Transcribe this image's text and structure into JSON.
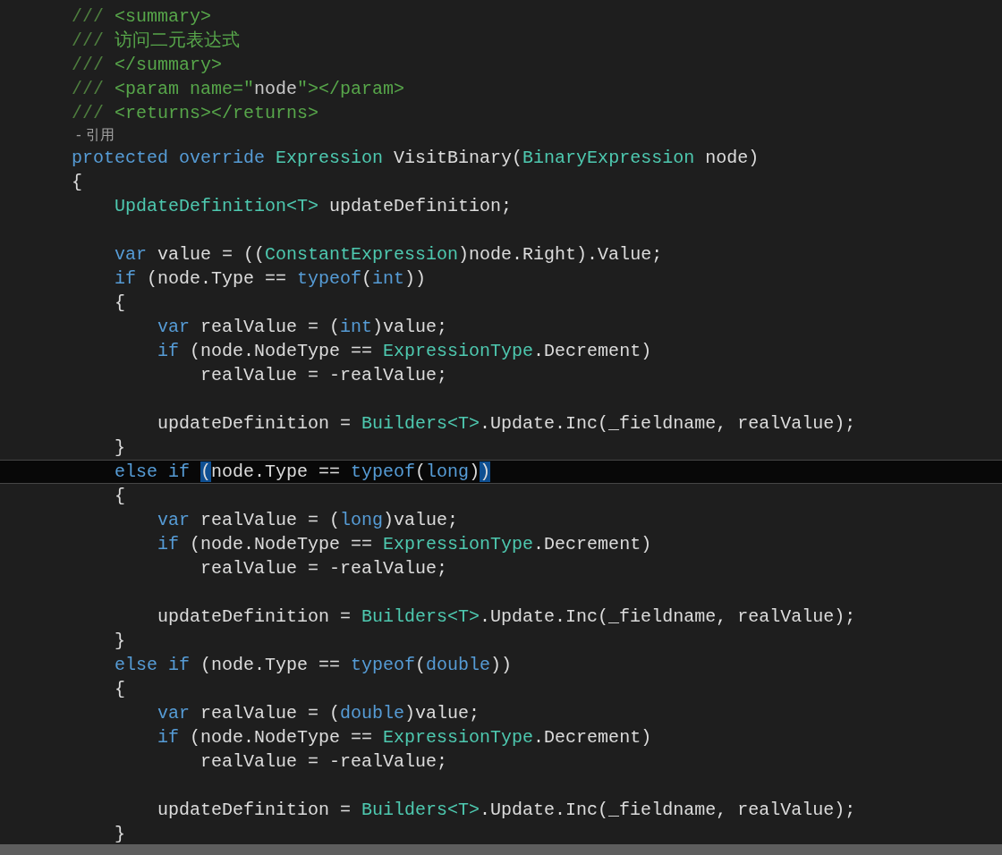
{
  "editor": {
    "lines": [
      {
        "kind": "code",
        "current": false,
        "tokens": [
          {
            "text": "///",
            "kind": "doc"
          },
          {
            "text": " <summary>",
            "kind": "comment"
          }
        ]
      },
      {
        "kind": "code",
        "current": false,
        "tokens": [
          {
            "text": "///",
            "kind": "doc"
          },
          {
            "text": " 访问二元表达式",
            "kind": "comment"
          }
        ]
      },
      {
        "kind": "code",
        "current": false,
        "tokens": [
          {
            "text": "///",
            "kind": "doc"
          },
          {
            "text": " </summary>",
            "kind": "comment"
          }
        ]
      },
      {
        "kind": "code",
        "current": false,
        "tokens": [
          {
            "text": "///",
            "kind": "doc"
          },
          {
            "text": " <param name=\"",
            "kind": "comment"
          },
          {
            "text": "node",
            "kind": "doc-value"
          },
          {
            "text": "\"></param>",
            "kind": "comment"
          }
        ]
      },
      {
        "kind": "code",
        "current": false,
        "tokens": [
          {
            "text": "///",
            "kind": "doc"
          },
          {
            "text": " <returns></returns>",
            "kind": "comment"
          }
        ]
      },
      {
        "kind": "codelens",
        "tokens": [
          {
            "text": " - 引用",
            "kind": "codelens"
          }
        ]
      },
      {
        "kind": "code",
        "current": false,
        "tokens": [
          {
            "text": "protected override ",
            "kind": "keyword"
          },
          {
            "text": "Expression",
            "kind": "type"
          },
          {
            "text": " VisitBinary(",
            "kind": "plain"
          },
          {
            "text": "BinaryExpression",
            "kind": "type"
          },
          {
            "text": " node)",
            "kind": "plain"
          }
        ]
      },
      {
        "kind": "code",
        "current": false,
        "tokens": [
          {
            "text": "{",
            "kind": "plain"
          }
        ]
      },
      {
        "kind": "code",
        "current": false,
        "tokens": [
          {
            "text": "    UpdateDefinition<T>",
            "kind": "type"
          },
          {
            "text": " updateDefinition;",
            "kind": "plain"
          }
        ]
      },
      {
        "kind": "blank"
      },
      {
        "kind": "code",
        "current": false,
        "tokens": [
          {
            "text": "    var",
            "kind": "keyword"
          },
          {
            "text": " value = ((",
            "kind": "plain"
          },
          {
            "text": "ConstantExpression",
            "kind": "type"
          },
          {
            "text": ")node.Right).Value;",
            "kind": "plain"
          }
        ]
      },
      {
        "kind": "code",
        "current": false,
        "tokens": [
          {
            "text": "    if",
            "kind": "keyword"
          },
          {
            "text": " (node.Type == ",
            "kind": "plain"
          },
          {
            "text": "typeof",
            "kind": "keyword"
          },
          {
            "text": "(",
            "kind": "plain"
          },
          {
            "text": "int",
            "kind": "keyword"
          },
          {
            "text": "))",
            "kind": "plain"
          }
        ]
      },
      {
        "kind": "code",
        "current": false,
        "tokens": [
          {
            "text": "    {",
            "kind": "plain"
          }
        ]
      },
      {
        "kind": "code",
        "current": false,
        "tokens": [
          {
            "text": "        var",
            "kind": "keyword"
          },
          {
            "text": " realValue = (",
            "kind": "plain"
          },
          {
            "text": "int",
            "kind": "keyword"
          },
          {
            "text": ")value;",
            "kind": "plain"
          }
        ]
      },
      {
        "kind": "code",
        "current": false,
        "tokens": [
          {
            "text": "        if",
            "kind": "keyword"
          },
          {
            "text": " (node.NodeType == ",
            "kind": "plain"
          },
          {
            "text": "ExpressionType",
            "kind": "type"
          },
          {
            "text": ".Decrement)",
            "kind": "plain"
          }
        ]
      },
      {
        "kind": "code",
        "current": false,
        "tokens": [
          {
            "text": "            realValue = -realValue;",
            "kind": "plain"
          }
        ]
      },
      {
        "kind": "blank"
      },
      {
        "kind": "code",
        "current": false,
        "tokens": [
          {
            "text": "        updateDefinition = ",
            "kind": "plain"
          },
          {
            "text": "Builders<T>",
            "kind": "type"
          },
          {
            "text": ".Update.Inc(_fieldname, realValue);",
            "kind": "plain"
          }
        ]
      },
      {
        "kind": "code",
        "current": false,
        "tokens": [
          {
            "text": "    }",
            "kind": "plain"
          }
        ]
      },
      {
        "kind": "code",
        "current": true,
        "tokens": [
          {
            "text": "    else if ",
            "kind": "keyword"
          },
          {
            "text": "(",
            "kind": "paren-match"
          },
          {
            "text": "node.Type == ",
            "kind": "plain"
          },
          {
            "text": "typeof",
            "kind": "keyword"
          },
          {
            "text": "(",
            "kind": "plain"
          },
          {
            "text": "long",
            "kind": "keyword"
          },
          {
            "text": ")",
            "kind": "plain"
          },
          {
            "text": ")",
            "kind": "paren-match"
          }
        ]
      },
      {
        "kind": "code",
        "current": false,
        "tokens": [
          {
            "text": "    {",
            "kind": "plain"
          }
        ]
      },
      {
        "kind": "code",
        "current": false,
        "tokens": [
          {
            "text": "        var",
            "kind": "keyword"
          },
          {
            "text": " realValue = (",
            "kind": "plain"
          },
          {
            "text": "long",
            "kind": "keyword"
          },
          {
            "text": ")value;",
            "kind": "plain"
          }
        ]
      },
      {
        "kind": "code",
        "current": false,
        "tokens": [
          {
            "text": "        if",
            "kind": "keyword"
          },
          {
            "text": " (node.NodeType == ",
            "kind": "plain"
          },
          {
            "text": "ExpressionType",
            "kind": "type"
          },
          {
            "text": ".Decrement)",
            "kind": "plain"
          }
        ]
      },
      {
        "kind": "code",
        "current": false,
        "tokens": [
          {
            "text": "            realValue = -realValue;",
            "kind": "plain"
          }
        ]
      },
      {
        "kind": "blank"
      },
      {
        "kind": "code",
        "current": false,
        "tokens": [
          {
            "text": "        updateDefinition = ",
            "kind": "plain"
          },
          {
            "text": "Builders<T>",
            "kind": "type"
          },
          {
            "text": ".Update.Inc(_fieldname, realValue);",
            "kind": "plain"
          }
        ]
      },
      {
        "kind": "code",
        "current": false,
        "tokens": [
          {
            "text": "    }",
            "kind": "plain"
          }
        ]
      },
      {
        "kind": "code",
        "current": false,
        "tokens": [
          {
            "text": "    else if",
            "kind": "keyword"
          },
          {
            "text": " (node.Type == ",
            "kind": "plain"
          },
          {
            "text": "typeof",
            "kind": "keyword"
          },
          {
            "text": "(",
            "kind": "plain"
          },
          {
            "text": "double",
            "kind": "keyword"
          },
          {
            "text": "))",
            "kind": "plain"
          }
        ]
      },
      {
        "kind": "code",
        "current": false,
        "tokens": [
          {
            "text": "    {",
            "kind": "plain"
          }
        ]
      },
      {
        "kind": "code",
        "current": false,
        "tokens": [
          {
            "text": "        var",
            "kind": "keyword"
          },
          {
            "text": " realValue = (",
            "kind": "plain"
          },
          {
            "text": "double",
            "kind": "keyword"
          },
          {
            "text": ")value;",
            "kind": "plain"
          }
        ]
      },
      {
        "kind": "code",
        "current": false,
        "tokens": [
          {
            "text": "        if",
            "kind": "keyword"
          },
          {
            "text": " (node.NodeType == ",
            "kind": "plain"
          },
          {
            "text": "ExpressionType",
            "kind": "type"
          },
          {
            "text": ".Decrement)",
            "kind": "plain"
          }
        ]
      },
      {
        "kind": "code",
        "current": false,
        "tokens": [
          {
            "text": "            realValue = -realValue;",
            "kind": "plain"
          }
        ]
      },
      {
        "kind": "blank"
      },
      {
        "kind": "code",
        "current": false,
        "tokens": [
          {
            "text": "        updateDefinition = ",
            "kind": "plain"
          },
          {
            "text": "Builders<T>",
            "kind": "type"
          },
          {
            "text": ".Update.Inc(_fieldname, realValue);",
            "kind": "plain"
          }
        ]
      },
      {
        "kind": "code",
        "current": false,
        "tokens": [
          {
            "text": "    }",
            "kind": "plain"
          }
        ]
      }
    ]
  }
}
